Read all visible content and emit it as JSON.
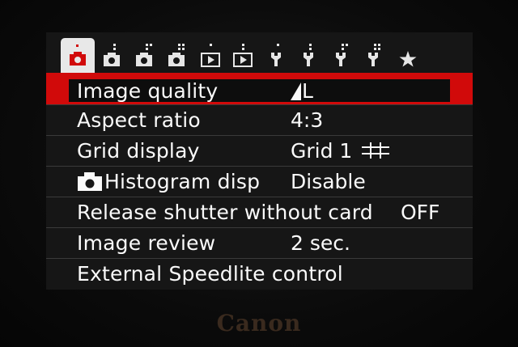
{
  "tabs": [
    {
      "icon": "camera-icon",
      "dots": 1,
      "active": true
    },
    {
      "icon": "camera-icon",
      "dots": 2,
      "active": false
    },
    {
      "icon": "camera-icon",
      "dots": 3,
      "active": false
    },
    {
      "icon": "camera-icon",
      "dots": 4,
      "active": false
    },
    {
      "icon": "playback-icon",
      "dots": 1,
      "active": false
    },
    {
      "icon": "playback-icon",
      "dots": 2,
      "active": false
    },
    {
      "icon": "wrench-icon",
      "dots": 1,
      "active": false
    },
    {
      "icon": "wrench-icon",
      "dots": 2,
      "active": false
    },
    {
      "icon": "wrench-icon",
      "dots": 3,
      "active": false
    },
    {
      "icon": "wrench-icon",
      "dots": 4,
      "active": false
    },
    {
      "icon": "star-icon",
      "dots": 0,
      "active": false
    }
  ],
  "colors": {
    "accent": "#d10a0a",
    "text": "#fafafa",
    "background": "#161616"
  },
  "menu": [
    {
      "label": "Image quality",
      "value": "L",
      "value_icon": "quality-fine-icon",
      "selected": true
    },
    {
      "label": "Aspect ratio",
      "value": "4:3"
    },
    {
      "label": "Grid display",
      "value": "Grid 1",
      "value_icon": "grid-icon"
    },
    {
      "label": "Histogram disp",
      "label_icon": "camera-icon",
      "value": "Disable"
    },
    {
      "label": "Release shutter without card",
      "value": "OFF"
    },
    {
      "label": "Image review",
      "value": "2 sec."
    },
    {
      "label": "External Speedlite control",
      "value": ""
    }
  ],
  "brand": "Canon"
}
